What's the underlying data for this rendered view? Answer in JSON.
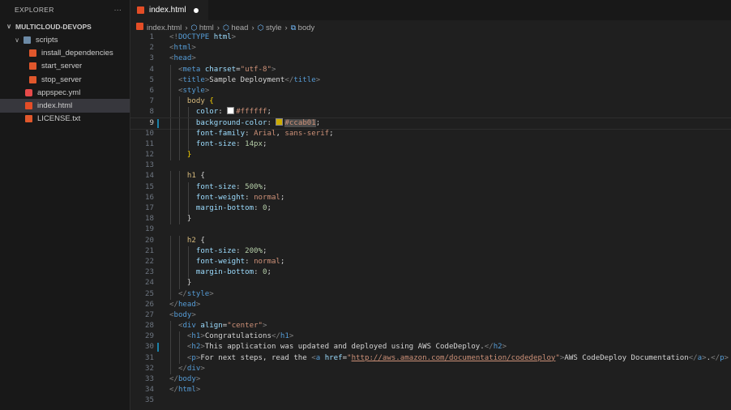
{
  "sidebar": {
    "title": "EXPLORER",
    "more": "···",
    "project": "MULTICLOUD-DEVOPS",
    "items": [
      {
        "label": "scripts",
        "icon": "folder-icon",
        "depth": 1,
        "folder": true
      },
      {
        "label": "install_dependencies",
        "icon": "shell-script-icon",
        "depth": 2
      },
      {
        "label": "start_server",
        "icon": "shell-script-icon",
        "depth": 2
      },
      {
        "label": "stop_server",
        "icon": "shell-script-icon",
        "depth": 2
      },
      {
        "label": "appspec.yml",
        "icon": "yaml-file-icon",
        "depth": 1
      },
      {
        "label": "index.html",
        "icon": "html5-icon",
        "depth": 1,
        "selected": true
      },
      {
        "label": "LICENSE.txt",
        "icon": "license-icon",
        "depth": 1
      }
    ]
  },
  "tab": {
    "label": "index.html",
    "modified": true
  },
  "breadcrumb": [
    "index.html",
    "html",
    "head",
    "style",
    "body"
  ],
  "colors": {
    "white_swatch": "#ffffff",
    "bg_swatch": "#ccab01"
  },
  "code": [
    {
      "i": 0,
      "t": [
        [
          "b",
          "<!"
        ],
        [
          "t",
          "DOCTYPE"
        ],
        [
          "x",
          " "
        ],
        [
          "a",
          "html"
        ],
        [
          "b",
          ">"
        ]
      ]
    },
    {
      "i": 0,
      "t": [
        [
          "b",
          "<"
        ],
        [
          "t",
          "html"
        ],
        [
          "b",
          ">"
        ]
      ]
    },
    {
      "i": 0,
      "t": [
        [
          "b",
          "<"
        ],
        [
          "t",
          "head"
        ],
        [
          "b",
          ">"
        ]
      ]
    },
    {
      "i": 1,
      "t": [
        [
          "b",
          "<"
        ],
        [
          "t",
          "meta"
        ],
        [
          "x",
          " "
        ],
        [
          "a",
          "charset"
        ],
        [
          "x",
          "="
        ],
        [
          "s",
          "\"utf-8\""
        ],
        [
          "b",
          ">"
        ]
      ]
    },
    {
      "i": 1,
      "t": [
        [
          "b",
          "<"
        ],
        [
          "t",
          "title"
        ],
        [
          "b",
          ">"
        ],
        [
          "x",
          "Sample Deployment"
        ],
        [
          "b",
          "</"
        ],
        [
          "t",
          "title"
        ],
        [
          "b",
          ">"
        ]
      ]
    },
    {
      "i": 1,
      "t": [
        [
          "b",
          "<"
        ],
        [
          "t",
          "style"
        ],
        [
          "b",
          ">"
        ]
      ]
    },
    {
      "i": 2,
      "t": [
        [
          "sel",
          "body"
        ],
        [
          "x",
          " "
        ],
        [
          "br",
          "{"
        ]
      ]
    },
    {
      "i": 3,
      "t": [
        [
          "p",
          "color"
        ],
        [
          "x",
          ": "
        ],
        [
          "sw",
          "#ffffff"
        ],
        [
          "v",
          "#ffffff"
        ],
        [
          "x",
          ";"
        ]
      ]
    },
    {
      "i": 3,
      "cur": true,
      "t": [
        [
          "p",
          "background-color"
        ],
        [
          "x",
          ": "
        ],
        [
          "sw",
          "#ccab01"
        ],
        [
          "hl",
          "#ccab01"
        ],
        [
          "x",
          ";"
        ]
      ]
    },
    {
      "i": 3,
      "t": [
        [
          "p",
          "font-family"
        ],
        [
          "x",
          ": "
        ],
        [
          "v",
          "Arial"
        ],
        [
          "x",
          ", "
        ],
        [
          "v",
          "sans-serif"
        ],
        [
          "x",
          ";"
        ]
      ]
    },
    {
      "i": 3,
      "t": [
        [
          "p",
          "font-size"
        ],
        [
          "x",
          ": "
        ],
        [
          "n",
          "14px"
        ],
        [
          "x",
          ";"
        ]
      ]
    },
    {
      "i": 2,
      "t": [
        [
          "br",
          "}"
        ]
      ]
    },
    {
      "i": 0,
      "t": []
    },
    {
      "i": 2,
      "t": [
        [
          "sel",
          "h1"
        ],
        [
          "x",
          " {"
        ]
      ]
    },
    {
      "i": 3,
      "t": [
        [
          "p",
          "font-size"
        ],
        [
          "x",
          ": "
        ],
        [
          "n",
          "500%"
        ],
        [
          "x",
          ";"
        ]
      ]
    },
    {
      "i": 3,
      "t": [
        [
          "p",
          "font-weight"
        ],
        [
          "x",
          ": "
        ],
        [
          "v",
          "normal"
        ],
        [
          "x",
          ";"
        ]
      ]
    },
    {
      "i": 3,
      "t": [
        [
          "p",
          "margin-bottom"
        ],
        [
          "x",
          ": "
        ],
        [
          "n",
          "0"
        ],
        [
          "x",
          ";"
        ]
      ]
    },
    {
      "i": 2,
      "t": [
        [
          "x",
          "}"
        ]
      ]
    },
    {
      "i": 0,
      "t": []
    },
    {
      "i": 2,
      "t": [
        [
          "sel",
          "h2"
        ],
        [
          "x",
          " {"
        ]
      ]
    },
    {
      "i": 3,
      "t": [
        [
          "p",
          "font-size"
        ],
        [
          "x",
          ": "
        ],
        [
          "n",
          "200%"
        ],
        [
          "x",
          ";"
        ]
      ]
    },
    {
      "i": 3,
      "t": [
        [
          "p",
          "font-weight"
        ],
        [
          "x",
          ": "
        ],
        [
          "v",
          "normal"
        ],
        [
          "x",
          ";"
        ]
      ]
    },
    {
      "i": 3,
      "t": [
        [
          "p",
          "margin-bottom"
        ],
        [
          "x",
          ": "
        ],
        [
          "n",
          "0"
        ],
        [
          "x",
          ";"
        ]
      ]
    },
    {
      "i": 2,
      "t": [
        [
          "x",
          "}"
        ]
      ]
    },
    {
      "i": 1,
      "t": [
        [
          "b",
          "</"
        ],
        [
          "t",
          "style"
        ],
        [
          "b",
          ">"
        ]
      ]
    },
    {
      "i": 0,
      "t": [
        [
          "b",
          "</"
        ],
        [
          "t",
          "head"
        ],
        [
          "b",
          ">"
        ]
      ]
    },
    {
      "i": 0,
      "t": [
        [
          "b",
          "<"
        ],
        [
          "t",
          "body"
        ],
        [
          "b",
          ">"
        ]
      ]
    },
    {
      "i": 1,
      "t": [
        [
          "b",
          "<"
        ],
        [
          "t",
          "div"
        ],
        [
          "x",
          " "
        ],
        [
          "a",
          "align"
        ],
        [
          "x",
          "="
        ],
        [
          "s",
          "\"center\""
        ],
        [
          "b",
          ">"
        ]
      ]
    },
    {
      "i": 2,
      "t": [
        [
          "b",
          "<"
        ],
        [
          "t",
          "h1"
        ],
        [
          "b",
          ">"
        ],
        [
          "x",
          "Congratulations"
        ],
        [
          "b",
          "</"
        ],
        [
          "t",
          "h1"
        ],
        [
          "b",
          ">"
        ]
      ]
    },
    {
      "i": 2,
      "mod": true,
      "t": [
        [
          "b",
          "<"
        ],
        [
          "t",
          "h2"
        ],
        [
          "b",
          ">"
        ],
        [
          "x",
          "This application was updated and deployed using AWS CodeDeploy."
        ],
        [
          "b",
          "</"
        ],
        [
          "t",
          "h2"
        ],
        [
          "b",
          ">"
        ]
      ]
    },
    {
      "i": 2,
      "t": [
        [
          "b",
          "<"
        ],
        [
          "t",
          "p"
        ],
        [
          "b",
          ">"
        ],
        [
          "x",
          "For next steps, read the "
        ],
        [
          "b",
          "<"
        ],
        [
          "t",
          "a"
        ],
        [
          "x",
          " "
        ],
        [
          "a",
          "href"
        ],
        [
          "x",
          "="
        ],
        [
          "s",
          "\""
        ],
        [
          "u",
          "http://aws.amazon.com/documentation/codedeploy"
        ],
        [
          "s",
          "\""
        ],
        [
          "b",
          ">"
        ],
        [
          "x",
          "AWS CodeDeploy Documentation"
        ],
        [
          "b",
          "</"
        ],
        [
          "t",
          "a"
        ],
        [
          "b",
          ">"
        ],
        [
          "x",
          "."
        ],
        [
          "b",
          "</"
        ],
        [
          "t",
          "p"
        ],
        [
          "b",
          ">"
        ]
      ]
    },
    {
      "i": 1,
      "t": [
        [
          "b",
          "</"
        ],
        [
          "t",
          "div"
        ],
        [
          "b",
          ">"
        ]
      ]
    },
    {
      "i": 0,
      "t": [
        [
          "b",
          "</"
        ],
        [
          "t",
          "body"
        ],
        [
          "b",
          ">"
        ]
      ]
    },
    {
      "i": 0,
      "t": [
        [
          "b",
          "</"
        ],
        [
          "t",
          "html"
        ],
        [
          "b",
          ">"
        ]
      ]
    },
    {
      "i": 0,
      "t": []
    }
  ]
}
